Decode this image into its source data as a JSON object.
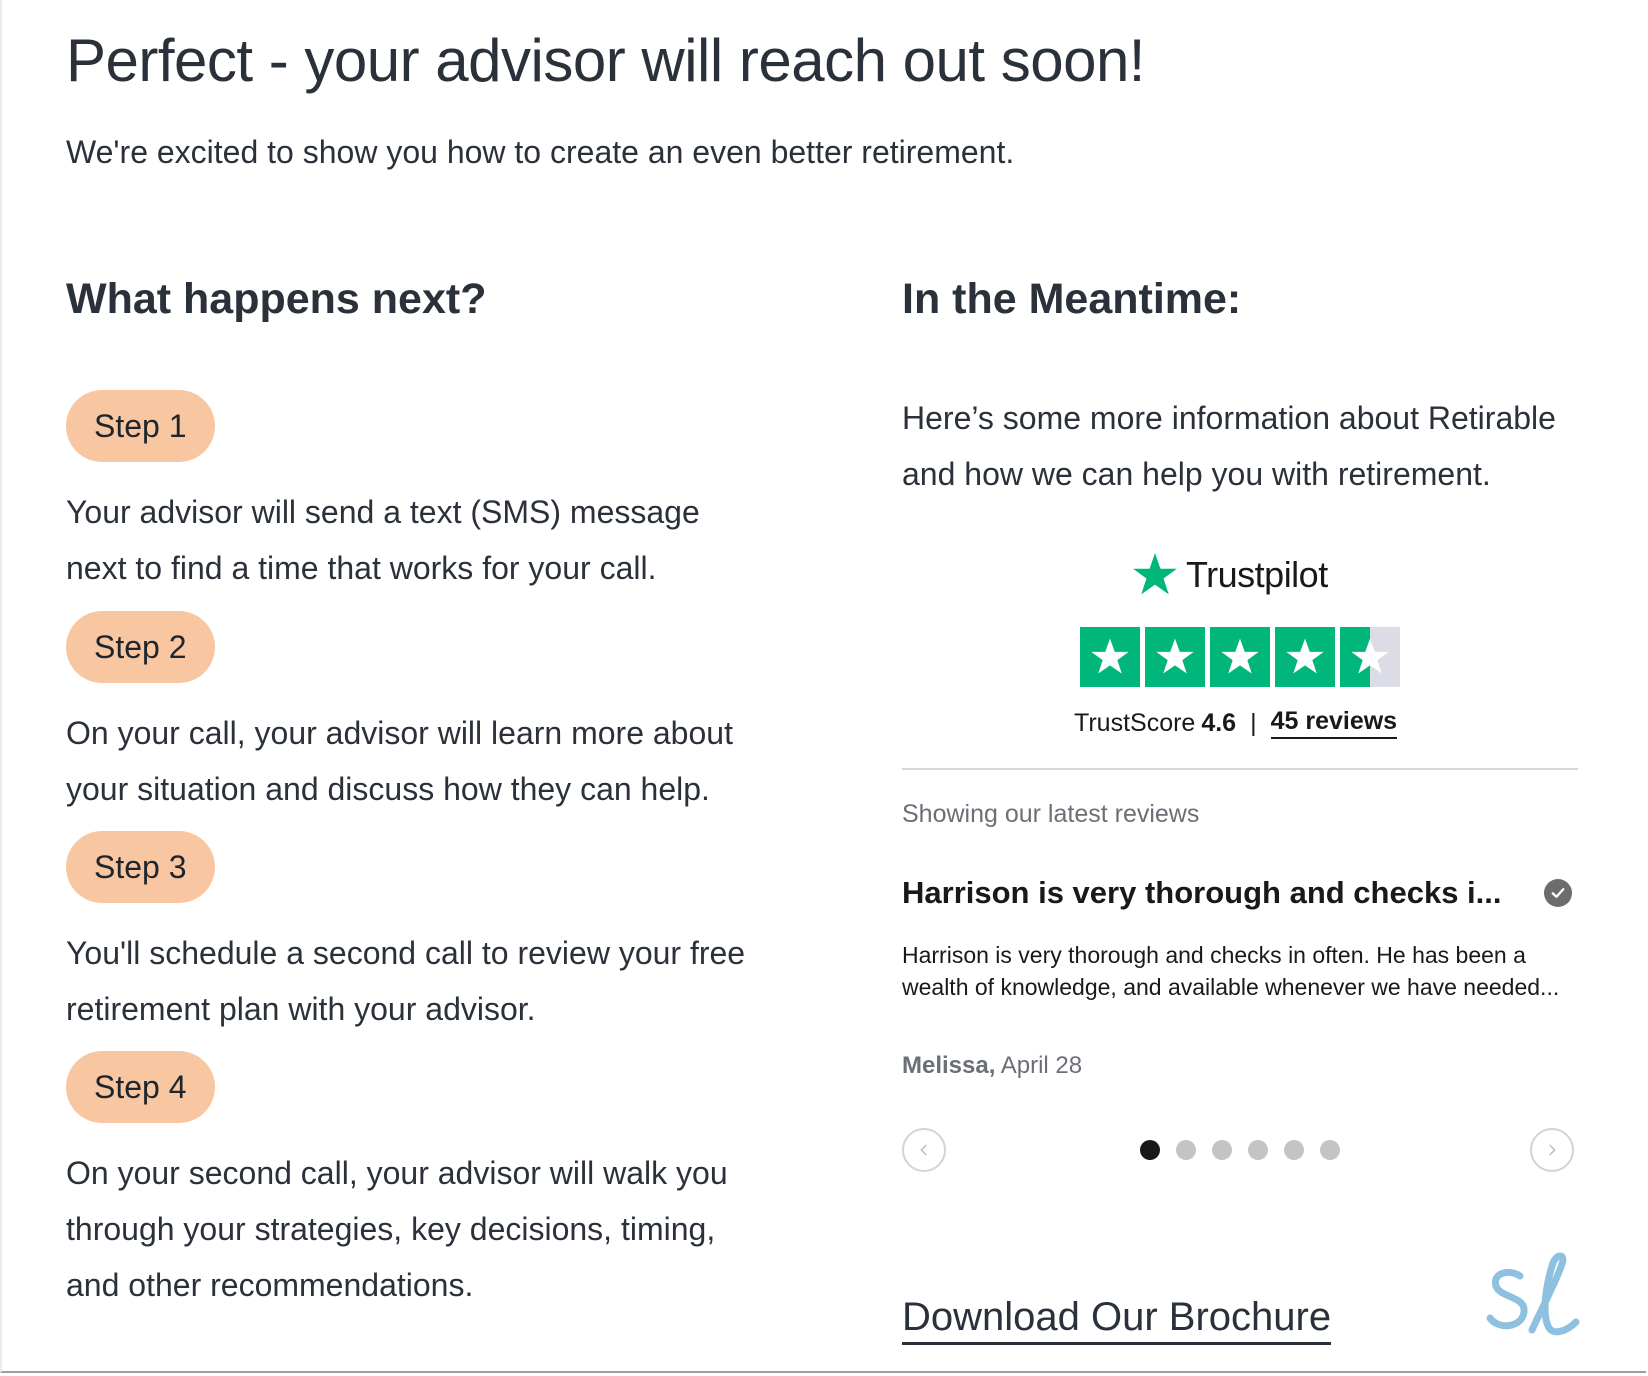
{
  "header": {
    "title": "Perfect - your advisor will reach out soon!",
    "subtitle": "We're excited to show you how to create an even better retirement."
  },
  "next_steps": {
    "title": "What happens next?",
    "steps": [
      {
        "label": "Step 1",
        "text": "Your advisor will send a text (SMS) message next to find a time that works for your call."
      },
      {
        "label": "Step 2",
        "text": "On your call, your advisor will learn more about your situation and discuss how they can help."
      },
      {
        "label": "Step 3",
        "text": "You'll schedule a second call to review your free retirement plan with your advisor."
      },
      {
        "label": "Step 4",
        "text": "On your second call, your advisor will walk you through your strategies, key decisions, timing, and other recommendations."
      }
    ]
  },
  "meantime": {
    "title": "In the Meantime:",
    "intro": "Here’s some more information about Retirable and how we can help you with retirement.",
    "brochure_link": "Download Our Brochure"
  },
  "trustpilot": {
    "logo_text": "Trustpilot",
    "star_rating": 4.5,
    "trustscore_label": "TrustScore",
    "trustscore_value": "4.6",
    "separator": "|",
    "reviews_link": "45 reviews",
    "showing_label": "Showing our latest reviews",
    "brand_color": "#00b67a",
    "review": {
      "title": "Harrison is very thorough and checks i...",
      "body": "Harrison is very thorough and checks in often. He has been a wealth of knowledge, and available whenever we have needed...",
      "author": "Melissa,",
      "date": "April 28"
    },
    "carousel": {
      "total_dots": 6,
      "active_index": 0
    }
  },
  "colors": {
    "step_pill": "#f8c7a2",
    "text": "#2b313a",
    "logo_accent": "#8ec1e0"
  },
  "icons": {
    "trustpilot_star": "star-icon",
    "verified": "check-circle-icon",
    "prev": "chevron-left-icon",
    "next": "chevron-right-icon",
    "brand_logo": "sl-logo"
  }
}
